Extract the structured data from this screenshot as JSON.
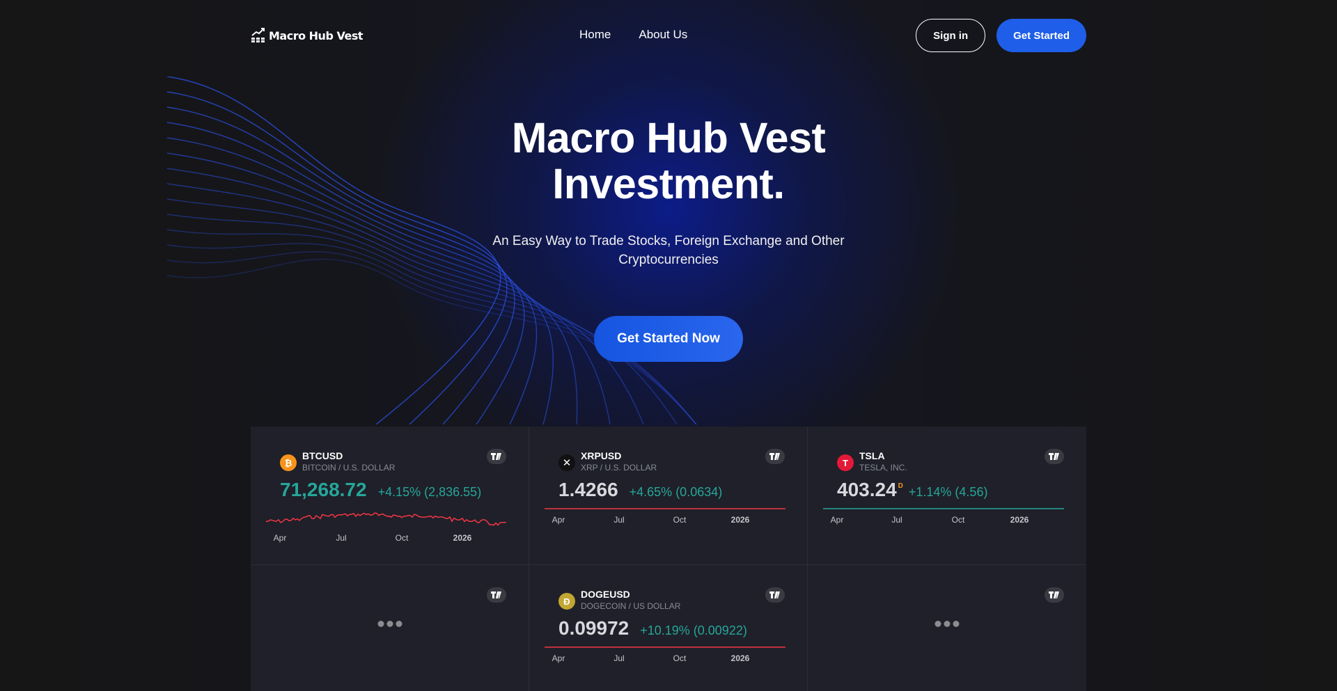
{
  "brand": {
    "name": "Macro Hub Vest"
  },
  "nav": {
    "items": [
      "Home",
      "About Us"
    ]
  },
  "header": {
    "signin_label": "Sign in",
    "get_started_label": "Get Started"
  },
  "hero": {
    "title_line1": "Macro Hub Vest",
    "title_line2": "Investment.",
    "subtitle_line1": "An Easy Way to Trade Stocks, Foreign Exchange and Other",
    "subtitle_line2": "Cryptocurrencies",
    "cta_label": "Get Started Now"
  },
  "colors": {
    "accent": "#1f5ee8",
    "positive": "#26a69a",
    "negative": "#f23645",
    "panel": "#1f2029"
  },
  "tickers": [
    {
      "symbol": "BTCUSD",
      "description": "BITCOIN / U.S. DOLLAR",
      "icon": "bitcoin-icon",
      "icon_glyph": "₿",
      "price": "71,268.72",
      "change": "+4.15% (2,836.55)",
      "axis": [
        "Apr",
        "Jul",
        "Oct",
        "2026"
      ]
    },
    {
      "symbol": "XRPUSD",
      "description": "XRP / U.S. DOLLAR",
      "icon": "xrp-icon",
      "icon_glyph": "✕",
      "price": "1.4266",
      "change": "+4.65% (0.0634)",
      "axis": [
        "Apr",
        "Jul",
        "Oct",
        "2026"
      ]
    },
    {
      "symbol": "TSLA",
      "description": "TESLA, INC.",
      "icon": "tesla-icon",
      "icon_glyph": "T",
      "price": "403.24",
      "price_suffix": "D",
      "change": "+1.14% (4.56)",
      "axis": [
        "Apr",
        "Jul",
        "Oct",
        "2026"
      ]
    },
    {
      "symbol": "DOGEUSD",
      "description": "DOGECOIN / US DOLLAR",
      "icon": "dogecoin-icon",
      "icon_glyph": "Ð",
      "price": "0.09972",
      "change": "+10.19% (0.00922)",
      "axis": [
        "Apr",
        "Jul",
        "Oct",
        "2026"
      ]
    }
  ]
}
